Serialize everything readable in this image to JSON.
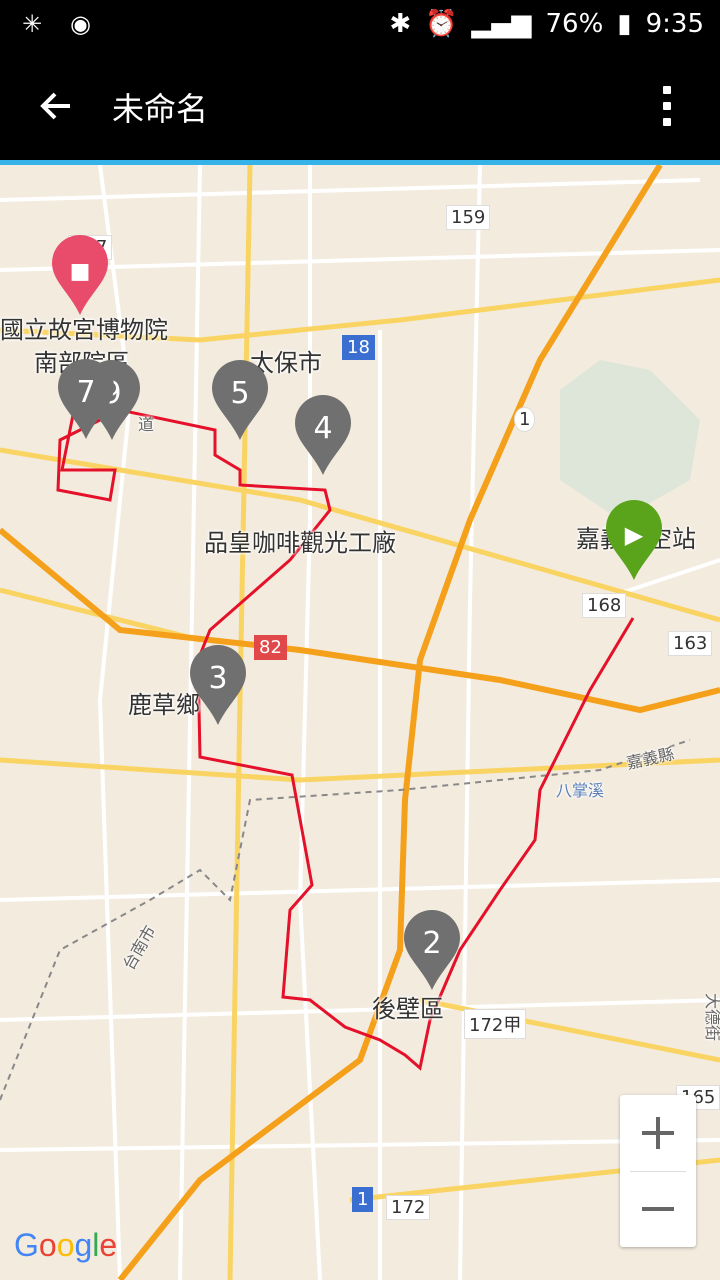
{
  "status": {
    "battery": "76%",
    "time": "9:35"
  },
  "appbar": {
    "title": "未命名"
  },
  "map": {
    "place_labels": [
      "國立故宮博物院",
      "南部院區",
      "太保市",
      "品皇咖啡觀光工廠",
      "嘉義航空站",
      "鹿草鄉",
      "後壁區"
    ],
    "route_shields": [
      "157",
      "159",
      "18",
      "1",
      "168",
      "163",
      "82",
      "172甲",
      "165",
      "1",
      "172"
    ],
    "small_labels": [
      "嘉義縣",
      "八掌溪",
      "台南市",
      "大德街",
      "道"
    ],
    "markers": [
      "2",
      "3",
      "4",
      "5",
      "7",
      "9"
    ],
    "start_marker": "start",
    "end_marker": "stop",
    "attribution": "Google"
  },
  "zoom": {
    "in": "+",
    "out": "−"
  },
  "colors": {
    "route": "#e5102a",
    "highway": "#f5a01a",
    "start": "#5aa41c",
    "end": "#e84c6a",
    "marker": "#707070",
    "accent": "#35b3e8"
  }
}
